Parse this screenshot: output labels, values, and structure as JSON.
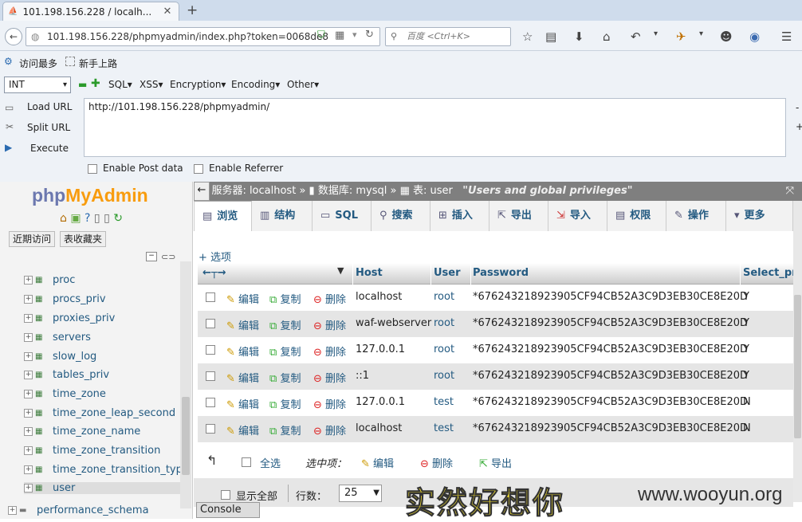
{
  "browser": {
    "tab_title": "101.198.156.228 / localh...",
    "url": "101.198.156.228/phpmyadmin/index.php?token=0068de8",
    "search_placeholder": "百度 <Ctrl+K>",
    "bookmarks": [
      "访问最多",
      "新手上路"
    ]
  },
  "hackbar": {
    "select_value": "INT",
    "menus": [
      "SQL▾",
      "XSS▾",
      "Encryption▾",
      "Encoding▾",
      "Other▾"
    ],
    "load_url": "Load URL",
    "split_url": "Split URL",
    "execute": "Execute",
    "url_value": "http://101.198.156.228/phpmyadmin/",
    "enable_post": "Enable Post data",
    "enable_referrer": "Enable Referrer"
  },
  "pma_left": {
    "logo_php": "php",
    "logo_myadmin": "MyAdmin",
    "tabs": [
      "近期访问",
      "表收藏夹"
    ],
    "tree": [
      "proc",
      "procs_priv",
      "proxies_priv",
      "servers",
      "slow_log",
      "tables_priv",
      "time_zone",
      "time_zone_leap_second",
      "time_zone_name",
      "time_zone_transition",
      "time_zone_transition_type",
      "user"
    ],
    "db_node": "performance_schema"
  },
  "breadcrumb": {
    "server": "服务器: localhost",
    "db": "数据库: mysql",
    "table": "表: user",
    "comment": "\"Users and global privileges\""
  },
  "tabs": [
    "浏览",
    "结构",
    "SQL",
    "搜索",
    "插入",
    "导出",
    "导入",
    "权限",
    "操作",
    "更多"
  ],
  "options_link": "+ 选项",
  "table": {
    "columns": [
      "Host",
      "User",
      "Password",
      "Select_pr"
    ],
    "actions": [
      "编辑",
      "复制",
      "删除"
    ],
    "rows": [
      {
        "host": "localhost",
        "user": "root",
        "password": "*676243218923905CF94CB52A3C9D3EB30CE8E20D",
        "select": "Y"
      },
      {
        "host": "waf-webserver",
        "user": "root",
        "password": "*676243218923905CF94CB52A3C9D3EB30CE8E20D",
        "select": "Y"
      },
      {
        "host": "127.0.0.1",
        "user": "root",
        "password": "*676243218923905CF94CB52A3C9D3EB30CE8E20D",
        "select": "Y"
      },
      {
        "host": "::1",
        "user": "root",
        "password": "*676243218923905CF94CB52A3C9D3EB30CE8E20D",
        "select": "Y"
      },
      {
        "host": "127.0.0.1",
        "user": "test",
        "password": "*676243218923905CF94CB52A3C9D3EB30CE8E20D",
        "select": "N"
      },
      {
        "host": "localhost",
        "user": "test",
        "password": "*676243218923905CF94CB52A3C9D3EB30CE8E20D",
        "select": "N"
      }
    ]
  },
  "footer_actions": {
    "select_all": "全选",
    "with_selected": "选中项：",
    "edit": "编辑",
    "delete": "删除",
    "export": "导出"
  },
  "pager": {
    "show_all": "显示全部",
    "rows_label": "行数：",
    "rows_value": "25"
  },
  "console": "Console",
  "watermark": {
    "cn": "实然好想你",
    "url": "www.wooyun.org"
  }
}
